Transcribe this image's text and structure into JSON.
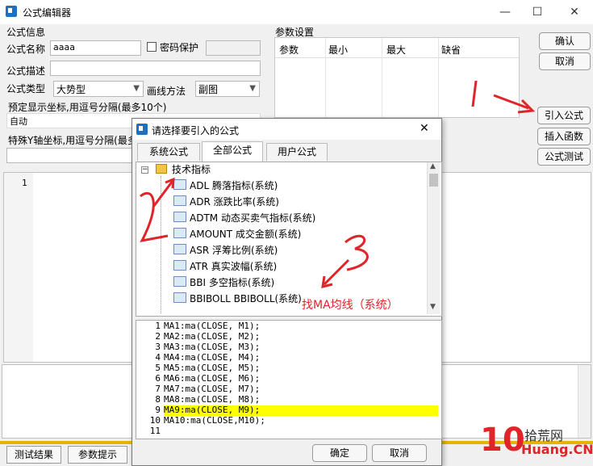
{
  "window": {
    "title": "公式编辑器",
    "minimize": "—",
    "maximize": "☐",
    "close": "✕"
  },
  "formula_info": {
    "group_label": "公式信息",
    "name_label": "公式名称",
    "name_value": "aaaa",
    "password_label": "密码保护",
    "desc_label": "公式描述",
    "type_label": "公式类型",
    "type_value": "大势型",
    "draw_label": "画线方法",
    "draw_value": "副图",
    "preset_label": "预定显示坐标,用逗号分隔(最多10个)",
    "preset_value": "自动",
    "special_label": "特殊Y轴坐标,用逗号分隔(最多"
  },
  "params": {
    "group_label": "参数设置",
    "columns": [
      "参数",
      "最小",
      "最大",
      "缺省"
    ]
  },
  "buttons": {
    "ok": "确认",
    "cancel": "取消",
    "import": "引入公式",
    "insert": "插入函数",
    "test": "公式测试"
  },
  "editor": {
    "line1": "1"
  },
  "bottom_tabs": [
    "测试结果",
    "参数提示"
  ],
  "dialog": {
    "title": "请选择要引入的公式",
    "close": "✕",
    "tabs": [
      "系统公式",
      "全部公式",
      "用户公式"
    ],
    "tree_root": "技术指标",
    "tree_items": [
      "ADL 腾落指标(系统)",
      "ADR 涨跌比率(系统)",
      "ADTM 动态买卖气指标(系统)",
      "AMOUNT 成交金额(系统)",
      "ASR 浮筹比例(系统)",
      "ATR 真实波幅(系统)",
      "BBI 多空指标(系统)",
      "BBIBOLL BBIBOLL(系统)"
    ],
    "code_lines": [
      "MA1:ma(CLOSE, M1);",
      "MA2:ma(CLOSE, M2);",
      "MA3:ma(CLOSE, M3);",
      "MA4:ma(CLOSE, M4);",
      "MA5:ma(CLOSE, M5);",
      "MA6:ma(CLOSE, M6);",
      "MA7:ma(CLOSE, M7);",
      "MA8:ma(CLOSE, M8);",
      "MA9:ma(CLOSE, M9);",
      "MA10:ma(CLOSE,M10);",
      ""
    ],
    "ok": "确定",
    "cancel": "取消"
  },
  "annotations": {
    "n1": "1",
    "n2": "2",
    "n3": "3",
    "find_ma": "找MA均线（系统）"
  },
  "watermark": {
    "big": "10",
    "cn": "拾荒网",
    "url": "Huang.CN"
  },
  "colors": {
    "annotation": "#e0242a",
    "highlight": "#ffff00"
  }
}
